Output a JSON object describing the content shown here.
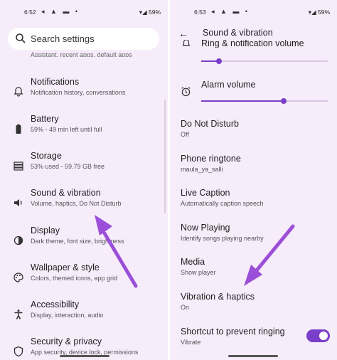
{
  "left": {
    "status": {
      "time": "6:52",
      "battery": "59%"
    },
    "search_placeholder": "Search settings",
    "cutoff_text": "Assistant, recent apps, default apps",
    "items": [
      {
        "title": "Notifications",
        "subtitle": "Notification history, conversations",
        "icon": "bell-icon"
      },
      {
        "title": "Battery",
        "subtitle": "59% - 49 min left until full",
        "icon": "battery-icon"
      },
      {
        "title": "Storage",
        "subtitle": "53% used - 59.79 GB free",
        "icon": "storage-icon"
      },
      {
        "title": "Sound & vibration",
        "subtitle": "Volume, haptics, Do Not Disturb",
        "icon": "speaker-icon"
      },
      {
        "title": "Display",
        "subtitle": "Dark theme, font size, brightness",
        "icon": "brightness-icon"
      },
      {
        "title": "Wallpaper & style",
        "subtitle": "Colors, themed icons, app grid",
        "icon": "palette-icon"
      },
      {
        "title": "Accessibility",
        "subtitle": "Display, interaction, audio",
        "icon": "accessibility-icon"
      },
      {
        "title": "Security & privacy",
        "subtitle": "App security, device lock, permissions",
        "icon": "shield-icon"
      }
    ]
  },
  "right": {
    "status": {
      "time": "6:53",
      "battery": "59%"
    },
    "title": "Sound & vibration",
    "ring_label": "Ring & notification volume",
    "ring_level": 0.14,
    "alarm_label": "Alarm volume",
    "alarm_level": 0.65,
    "items": [
      {
        "title": "Do Not Disturb",
        "subtitle": "Off"
      },
      {
        "title": "Phone ringtone",
        "subtitle": "maula_ya_salli"
      },
      {
        "title": "Live Caption",
        "subtitle": "Automatically caption speech"
      },
      {
        "title": "Now Playing",
        "subtitle": "Identify songs playing nearby"
      },
      {
        "title": "Media",
        "subtitle": "Show player"
      },
      {
        "title": "Vibration & haptics",
        "subtitle": "On"
      },
      {
        "title": "Shortcut to prevent ringing",
        "subtitle": "Vibrate"
      }
    ],
    "shortcut_toggle_on": true
  },
  "colors": {
    "background": "#f6ecfa",
    "accent": "#7a3fc8",
    "arrow": "#9b4fd8"
  }
}
